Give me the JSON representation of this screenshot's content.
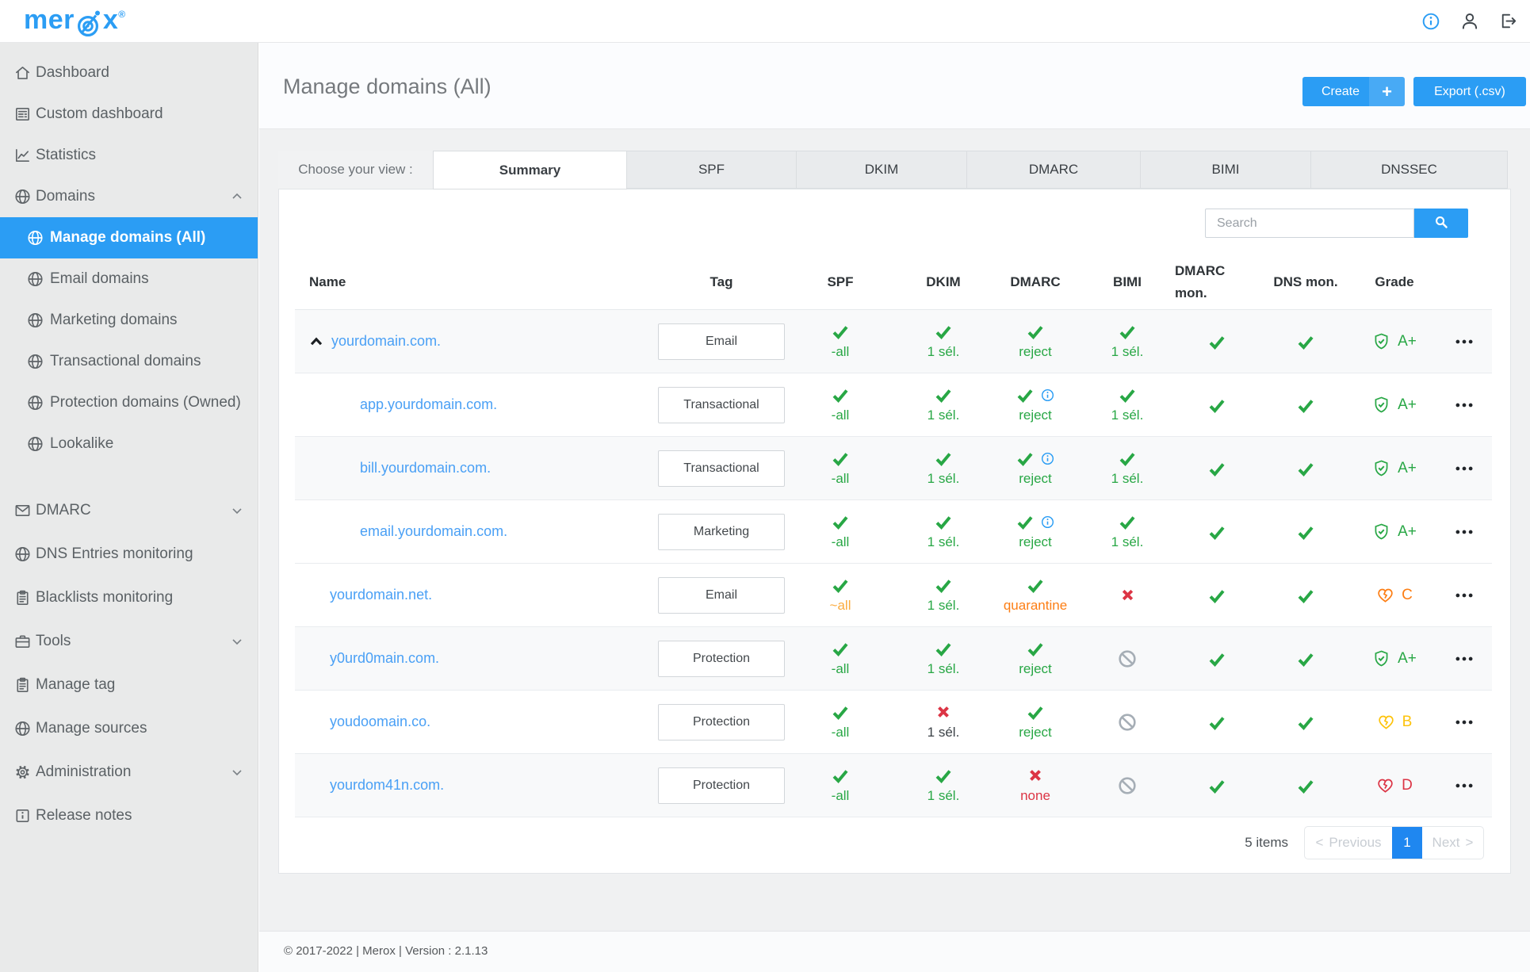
{
  "brand": {
    "logo_text_pre": "mer",
    "logo_text_post": "x",
    "registered": "®"
  },
  "topbar": {
    "icons": [
      "info",
      "user",
      "logout"
    ]
  },
  "sidebar": {
    "items": [
      {
        "label": "Dashboard",
        "icon": "home"
      },
      {
        "label": "Custom dashboard",
        "icon": "article"
      },
      {
        "label": "Statistics",
        "icon": "chart"
      },
      {
        "label": "Domains",
        "icon": "globe",
        "chevron": "up"
      },
      {
        "label": "Manage domains (All)",
        "icon": "globe",
        "child": true,
        "active": true
      },
      {
        "label": "Email domains",
        "icon": "globe",
        "child": true
      },
      {
        "label": "Marketing domains",
        "icon": "globe",
        "child": true
      },
      {
        "label": "Transactional domains",
        "icon": "globe",
        "child": true
      },
      {
        "label": "Protection domains (Owned)",
        "icon": "globe",
        "child": true
      },
      {
        "label": "Lookalike",
        "icon": "globe",
        "child": true
      },
      {
        "label": "DMARC",
        "icon": "mail",
        "chevron": "down"
      },
      {
        "label": "DNS Entries monitoring",
        "icon": "globe"
      },
      {
        "label": "Blacklists monitoring",
        "icon": "clipboard"
      },
      {
        "label": "Tools",
        "icon": "briefcase",
        "chevron": "down"
      },
      {
        "label": "Manage tag",
        "icon": "clipboard"
      },
      {
        "label": "Manage sources",
        "icon": "globe"
      },
      {
        "label": "Administration",
        "icon": "gear",
        "chevron": "down"
      },
      {
        "label": "Release notes",
        "icon": "info-square"
      }
    ]
  },
  "page": {
    "title": "Manage domains (All)",
    "create_label": "Create",
    "create_plus": "+",
    "export_label": "Export (.csv)"
  },
  "tabs": {
    "label": "Choose your view :",
    "items": [
      {
        "label": "Summary",
        "active": true
      },
      {
        "label": "SPF"
      },
      {
        "label": "DKIM"
      },
      {
        "label": "DMARC"
      },
      {
        "label": "BIMI"
      },
      {
        "label": "DNSSEC"
      }
    ]
  },
  "search": {
    "placeholder": "Search"
  },
  "table": {
    "columns": [
      "Name",
      "Tag",
      "SPF",
      "DKIM",
      "DMARC",
      "BIMI",
      "DMARC mon.",
      "DNS mon.",
      "Grade"
    ],
    "rows": [
      {
        "name": "yourdomain.com.",
        "caret": true,
        "child": false,
        "striped": true,
        "tag": "Email",
        "spf": {
          "icon": "check",
          "text": "-all",
          "color": "green"
        },
        "dkim": {
          "icon": "check",
          "text": "1 sél.",
          "color": "green"
        },
        "dmarc": {
          "icon": "check",
          "info": false,
          "text": "reject",
          "color": "green"
        },
        "bimi": {
          "icon": "check",
          "text": "1 sél.",
          "color": "green"
        },
        "dmarc_mon": "check",
        "dns_mon": "check",
        "grade": {
          "icon": "shield",
          "letter": "A+",
          "color": "green"
        }
      },
      {
        "name": "app.yourdomain.com.",
        "caret": false,
        "child": true,
        "striped": false,
        "tag": "Transactional",
        "spf": {
          "icon": "check",
          "text": "-all",
          "color": "green"
        },
        "dkim": {
          "icon": "check",
          "text": "1 sél.",
          "color": "green"
        },
        "dmarc": {
          "icon": "check",
          "info": true,
          "text": "reject",
          "color": "green"
        },
        "bimi": {
          "icon": "check",
          "text": "1 sél.",
          "color": "green"
        },
        "dmarc_mon": "check",
        "dns_mon": "check",
        "grade": {
          "icon": "shield",
          "letter": "A+",
          "color": "green"
        }
      },
      {
        "name": "bill.yourdomain.com.",
        "caret": false,
        "child": true,
        "striped": true,
        "tag": "Transactional",
        "spf": {
          "icon": "check",
          "text": "-all",
          "color": "green"
        },
        "dkim": {
          "icon": "check",
          "text": "1 sél.",
          "color": "green"
        },
        "dmarc": {
          "icon": "check",
          "info": true,
          "text": "reject",
          "color": "green"
        },
        "bimi": {
          "icon": "check",
          "text": "1 sél.",
          "color": "green"
        },
        "dmarc_mon": "check",
        "dns_mon": "check",
        "grade": {
          "icon": "shield",
          "letter": "A+",
          "color": "green"
        }
      },
      {
        "name": "email.yourdomain.com.",
        "caret": false,
        "child": true,
        "striped": false,
        "tag": "Marketing",
        "spf": {
          "icon": "check",
          "text": "-all",
          "color": "green"
        },
        "dkim": {
          "icon": "check",
          "text": "1 sél.",
          "color": "green"
        },
        "dmarc": {
          "icon": "check",
          "info": true,
          "text": "reject",
          "color": "green"
        },
        "bimi": {
          "icon": "check",
          "text": "1 sél.",
          "color": "green"
        },
        "dmarc_mon": "check",
        "dns_mon": "check",
        "grade": {
          "icon": "shield",
          "letter": "A+",
          "color": "green"
        }
      },
      {
        "name": "yourdomain.net.",
        "caret": false,
        "child": false,
        "striped": false,
        "tag": "Email",
        "spf": {
          "icon": "check",
          "text": "~all",
          "color": "amberOrange"
        },
        "dkim": {
          "icon": "check",
          "text": "1 sél.",
          "color": "green"
        },
        "dmarc": {
          "icon": "check",
          "info": false,
          "text": "quarantine",
          "color": "orange"
        },
        "bimi": {
          "icon": "x"
        },
        "dmarc_mon": "check",
        "dns_mon": "check",
        "grade": {
          "icon": "heart",
          "letter": "C",
          "color": "orange"
        }
      },
      {
        "name": "y0urd0main.com.",
        "caret": false,
        "child": false,
        "striped": true,
        "tag": "Protection",
        "spf": {
          "icon": "check",
          "text": "-all",
          "color": "green"
        },
        "dkim": {
          "icon": "check",
          "text": "1 sél.",
          "color": "green"
        },
        "dmarc": {
          "icon": "check",
          "info": false,
          "text": "reject",
          "color": "green"
        },
        "bimi": {
          "icon": "ban"
        },
        "dmarc_mon": "check",
        "dns_mon": "check",
        "grade": {
          "icon": "shield",
          "letter": "A+",
          "color": "green"
        }
      },
      {
        "name": "youdoomain.co.",
        "caret": false,
        "child": false,
        "striped": false,
        "tag": "Protection",
        "spf": {
          "icon": "check",
          "text": "-all",
          "color": "green"
        },
        "dkim": {
          "icon": "x",
          "text": "1 sél.",
          "color": "dark"
        },
        "dmarc": {
          "icon": "check",
          "info": false,
          "text": "reject",
          "color": "green"
        },
        "bimi": {
          "icon": "ban"
        },
        "dmarc_mon": "check",
        "dns_mon": "check",
        "grade": {
          "icon": "heart",
          "letter": "B",
          "color": "yellow"
        }
      },
      {
        "name": "yourdom41n.com.",
        "caret": false,
        "child": false,
        "striped": true,
        "tag": "Protection",
        "spf": {
          "icon": "check",
          "text": "-all",
          "color": "green"
        },
        "dkim": {
          "icon": "check",
          "text": "1 sél.",
          "color": "green"
        },
        "dmarc": {
          "icon": "x",
          "info": false,
          "text": "none",
          "color": "red"
        },
        "bimi": {
          "icon": "ban"
        },
        "dmarc_mon": "check",
        "dns_mon": "check",
        "grade": {
          "icon": "heart",
          "letter": "D",
          "color": "red"
        }
      }
    ]
  },
  "pagination": {
    "count_label": "5 items",
    "prev_arrow": "<",
    "previous": "Previous",
    "page": "1",
    "next": "Next",
    "next_arrow": ">"
  },
  "footer": {
    "text": "© 2017-2022 | Merox | Version : 2.1.13"
  },
  "colors": {
    "primary": "#2b9df4",
    "link": "#4aa0f5",
    "green": "#28a745",
    "orange": "#fd7e14",
    "amberOrange": "#fbab3e",
    "yellow": "#fdc30b",
    "red": "#dc3545",
    "gray": "#a6aeb6",
    "dark": "#3c4247"
  }
}
